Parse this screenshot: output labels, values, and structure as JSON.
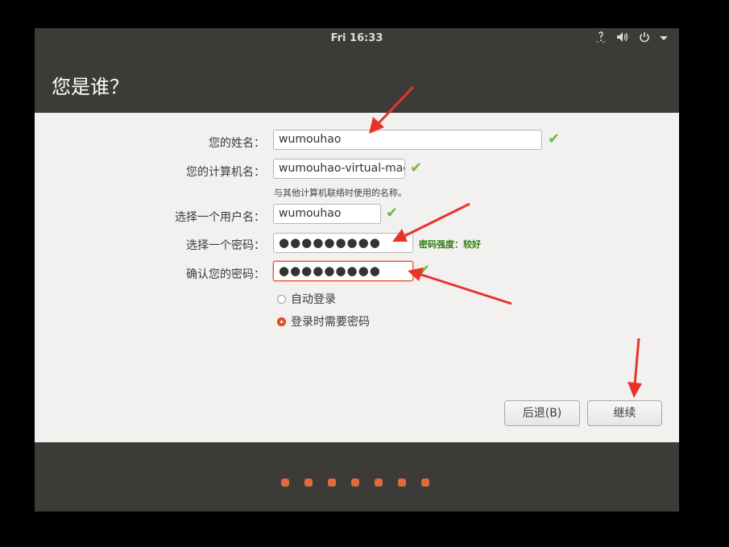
{
  "topbar": {
    "clock": "Fri 16:33",
    "icons": [
      "accessibility-icon",
      "volume-icon",
      "power-icon",
      "chevron-down-icon"
    ]
  },
  "page": {
    "title": "您是谁？"
  },
  "form": {
    "name_label": "您的姓名：",
    "name_value": "wumouhao",
    "computer_label": "您的计算机名：",
    "computer_value": "wumouhao-virtual-mac",
    "computer_hint": "与其他计算机联络时使用的名称。",
    "username_label": "选择一个用户名：",
    "username_value": "wumouhao",
    "password_label": "选择一个密码：",
    "password_value": "●●●●●●●●●",
    "password_strength": "密码强度：较好",
    "confirm_label": "确认您的密码：",
    "confirm_value": "●●●●●●●●●",
    "auto_login_label": "自动登录",
    "require_password_label": "登录时需要密码",
    "selected_login_option": "require_password"
  },
  "buttons": {
    "back_label": "后退(B)",
    "continue_label": "继续"
  },
  "progress": {
    "steps": 7
  },
  "colors": {
    "accent": "#e95420",
    "check": "#73b83b",
    "strength": "#2e7d14",
    "annotation": "#e8332b"
  }
}
